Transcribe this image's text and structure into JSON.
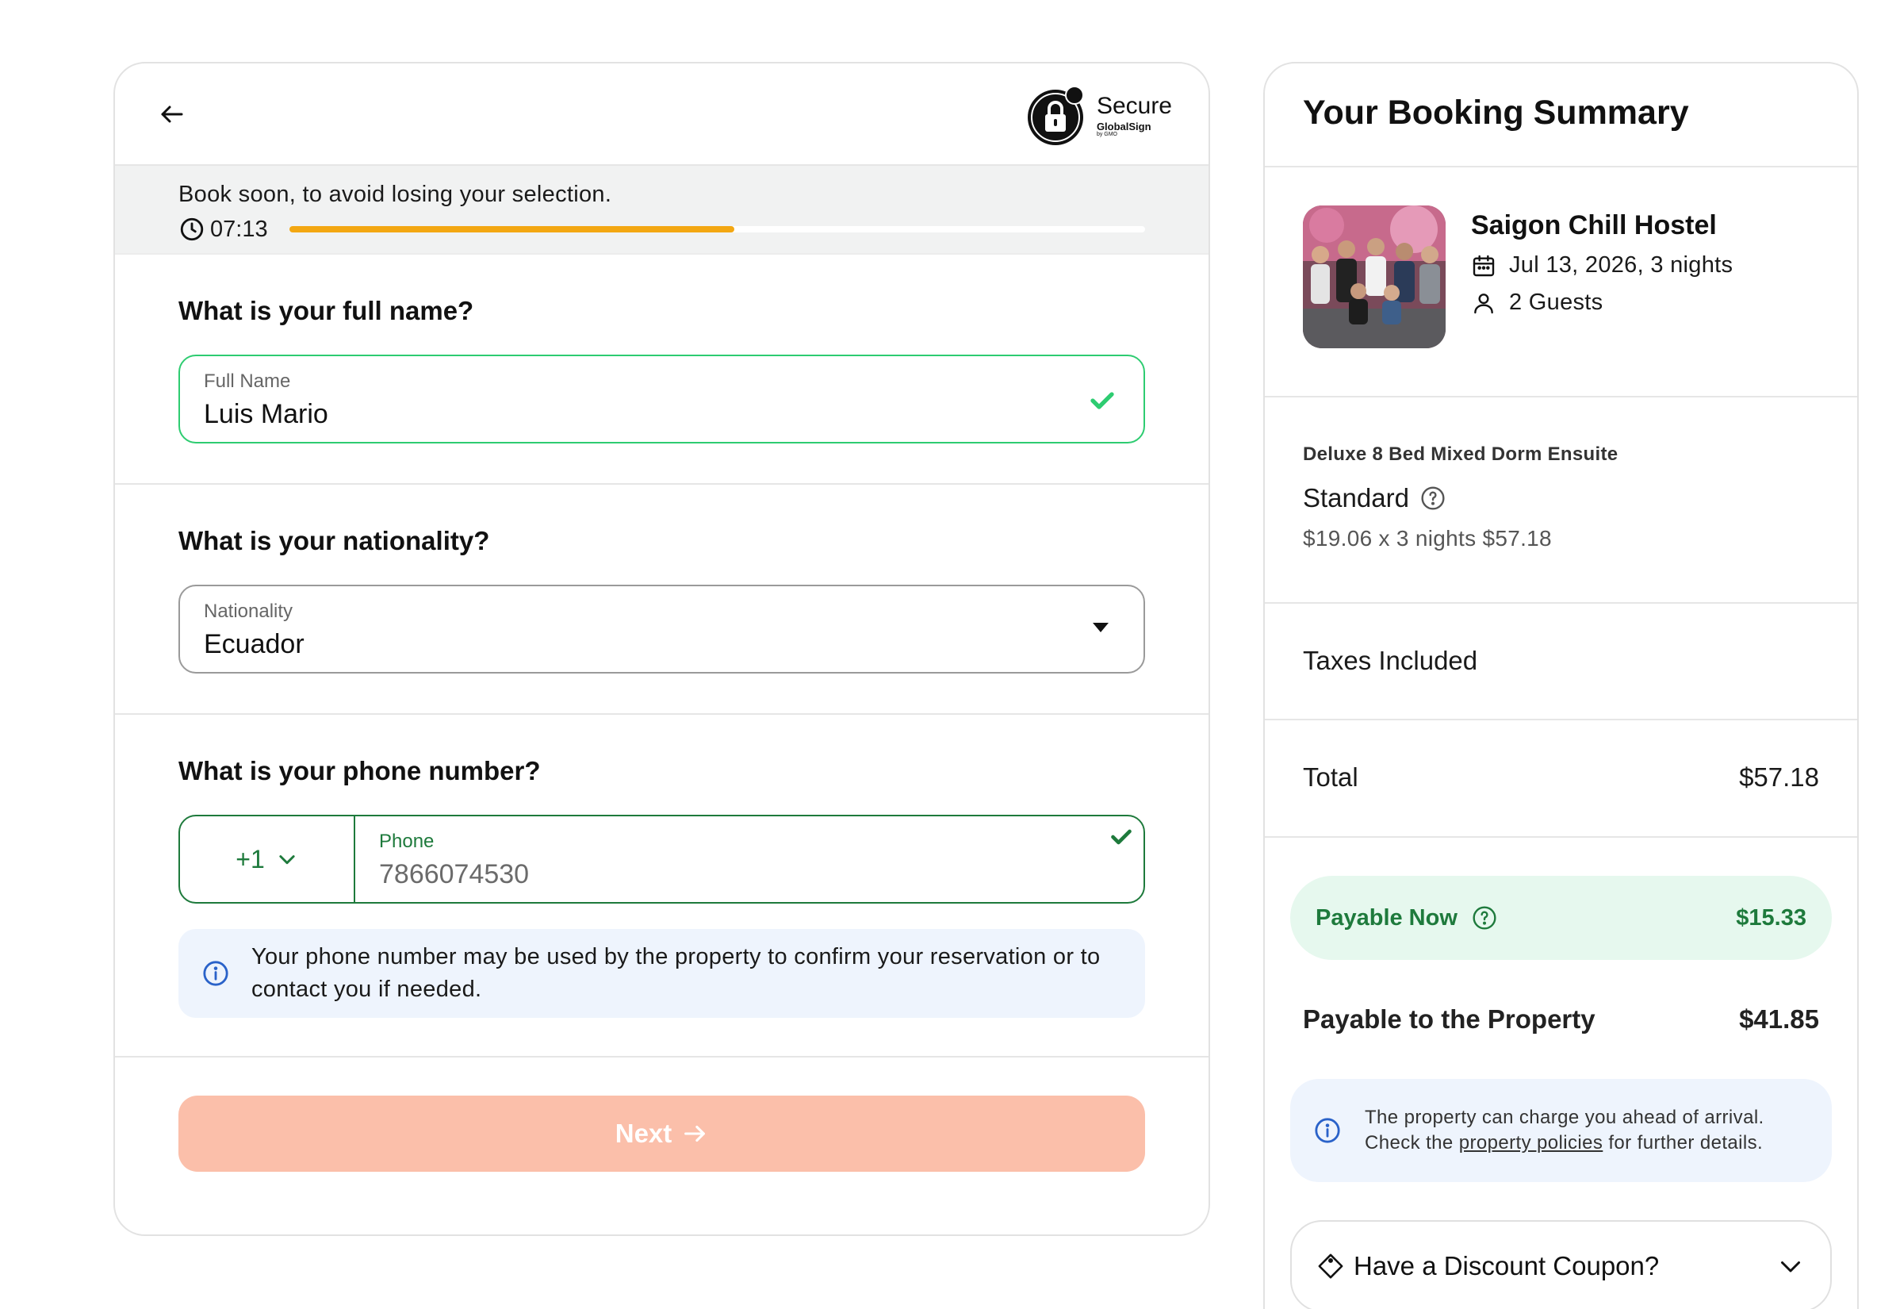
{
  "form": {
    "secure_badge": {
      "title": "Secure",
      "brand": "GlobalSign",
      "sub": "by GMO",
      "seal": "SSL"
    },
    "urgency": {
      "message": "Book soon, to avoid losing your selection.",
      "timer": "07:13",
      "progress": 0.52,
      "progress_color": "#f3a712"
    },
    "name_section": {
      "question": "What is your full name?",
      "label": "Full Name",
      "value": "Luis Mario"
    },
    "nationality_section": {
      "question": "What is your nationality?",
      "label": "Nationality",
      "value": "Ecuador"
    },
    "phone_section": {
      "question": "What is your phone number?",
      "country_code": "+1",
      "label": "Phone",
      "value": "7866074530",
      "info": "Your phone number may be used by the property to confirm your reservation or to contact you if needed."
    },
    "next_label": "Next"
  },
  "summary": {
    "title": "Your Booking Summary",
    "hostel_name": "Saigon Chill Hostel",
    "dates": "Jul 13, 2026, 3 nights",
    "guests": "2 Guests",
    "room_name": "Deluxe 8 Bed Mixed Dorm Ensuite",
    "rate_plan": "Standard",
    "room_price": "$19.06 x 3 nights $57.18",
    "taxes": "Taxes Included",
    "total_label": "Total",
    "total_value": "$57.18",
    "payable_now_label": "Payable Now",
    "payable_now_value": "$15.33",
    "payable_property_label": "Payable to the Property",
    "payable_property_value": "$41.85",
    "property_note_pre": "The property can charge you ahead of arrival. Check the ",
    "property_note_link": "property policies",
    "property_note_post": " for further details.",
    "coupon_label": "Have a Discount Coupon?"
  },
  "colors": {
    "accent_green": "#1e7a3c",
    "valid_green": "#2ecc71",
    "next_button": "#fbbfaa",
    "info_bg": "#eef4fd",
    "info_icon": "#2a62c9"
  }
}
